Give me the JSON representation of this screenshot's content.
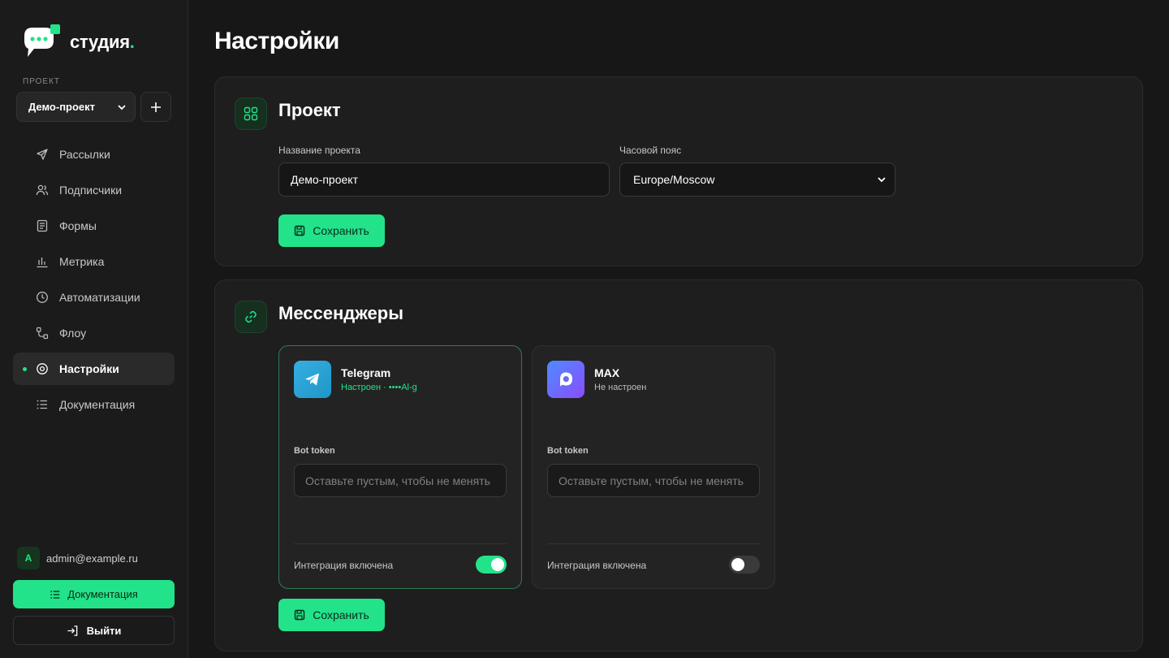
{
  "brand": {
    "name": "студия",
    "dot": ".",
    "accent": "#22e38a"
  },
  "sidebar": {
    "project_label": "ПРОЕКТ",
    "project_select": "Демо-проект",
    "nav": [
      {
        "label": "Рассылки",
        "icon": "send-icon"
      },
      {
        "label": "Подписчики",
        "icon": "users-icon"
      },
      {
        "label": "Формы",
        "icon": "form-icon"
      },
      {
        "label": "Метрика",
        "icon": "bar-chart-icon"
      },
      {
        "label": "Автоматизации",
        "icon": "clock-icon"
      },
      {
        "label": "Флоу",
        "icon": "flow-icon"
      },
      {
        "label": "Настройки",
        "icon": "gear-icon",
        "active": true
      },
      {
        "label": "Документация",
        "icon": "list-icon"
      }
    ],
    "user": {
      "initial": "A",
      "email": "admin@example.ru"
    },
    "docs_button": "Документация",
    "logout_button": "Выйти"
  },
  "page": {
    "title": "Настройки"
  },
  "project_card": {
    "title": "Проект",
    "name_label": "Название проекта",
    "name_value": "Демо-проект",
    "tz_label": "Часовой пояс",
    "tz_value": "Europe/Moscow",
    "save_label": "Сохранить"
  },
  "messengers_card": {
    "title": "Мессенджеры",
    "telegram": {
      "name": "Telegram",
      "status": "Настроен · ••••Al-g",
      "token_label": "Bot token",
      "token_placeholder": "Оставьте пустым, чтобы не менять",
      "toggle_label": "Интеграция включена",
      "enabled": true
    },
    "max": {
      "name": "MAX",
      "status": "Не настроен",
      "token_label": "Bot token",
      "token_placeholder": "Оставьте пустым, чтобы не менять",
      "toggle_label": "Интеграция включена",
      "enabled": false
    },
    "save_label": "Сохранить"
  }
}
